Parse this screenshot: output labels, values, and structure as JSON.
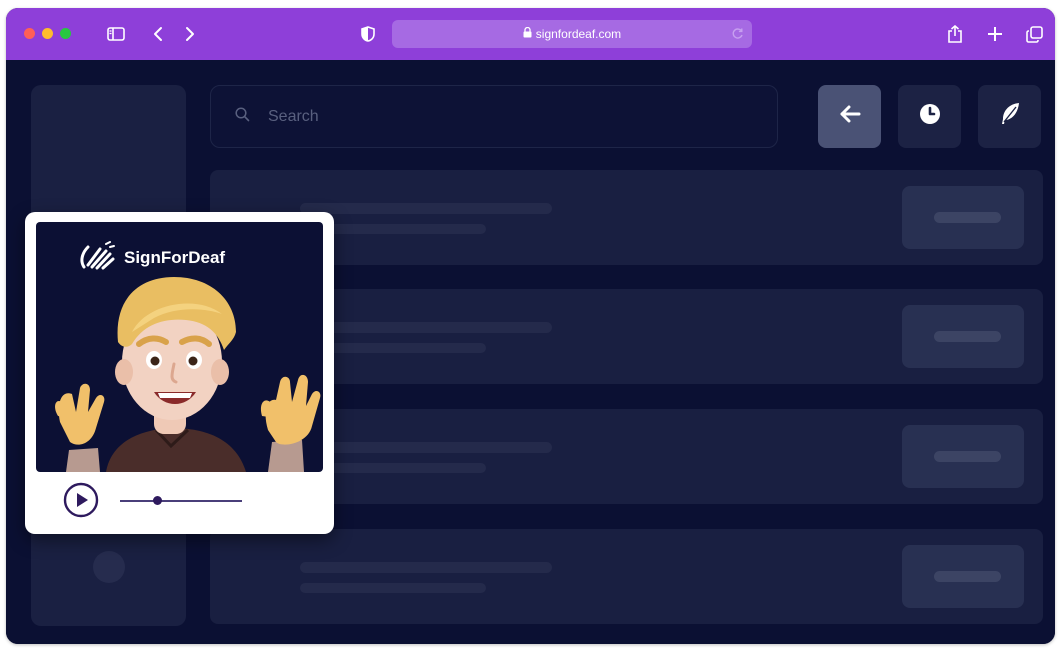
{
  "browser": {
    "url": "signfordeaf.com",
    "traffic_lights": {
      "close": "#ff5f57",
      "minimize": "#febc2e",
      "maximize": "#28c840"
    },
    "accent": "#8e3fd9",
    "icons": [
      "sidebar-toggle-icon",
      "back-chevron-icon",
      "forward-chevron-icon",
      "shield-icon",
      "lock-icon",
      "reload-icon",
      "share-icon",
      "new-tab-icon",
      "tab-overview-icon"
    ]
  },
  "app": {
    "search": {
      "placeholder": "Search"
    },
    "toolbar": {
      "buttons": [
        {
          "icon": "arrow-left-icon",
          "active": true
        },
        {
          "icon": "clock-icon",
          "active": false
        },
        {
          "icon": "feather-icon",
          "active": false
        }
      ]
    },
    "list_rows": 4
  },
  "widget": {
    "brand_name": "SignForDeaf",
    "player": {
      "state": "paused",
      "progress": 0.31
    }
  }
}
